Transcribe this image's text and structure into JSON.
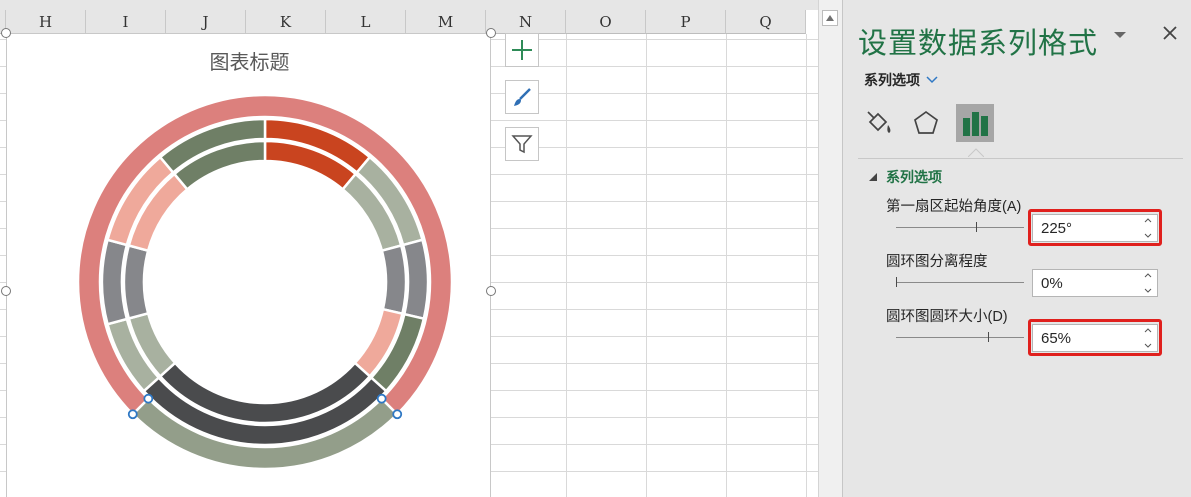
{
  "sheet": {
    "columns": [
      "H",
      "I",
      "J",
      "K",
      "L",
      "M",
      "N",
      "O",
      "P",
      "Q"
    ]
  },
  "chart": {
    "title": "图表标题",
    "side_buttons": [
      "chart-elements-plus-icon",
      "chart-styles-brush-icon",
      "chart-filters-funnel-icon"
    ],
    "colors": {
      "outer_ring": "#dc807d",
      "outer_ring_bottom": "#939e8a",
      "dark": "#4a4b4d",
      "accent_red": "#c9441f",
      "sage": "#a8b1a0",
      "gray": "#86878b",
      "salmon": "#efa99b",
      "olive": "#6f7f66"
    }
  },
  "pane": {
    "title": "设置数据系列格式",
    "tab_dropdown_label": "系列选项",
    "tabs": [
      "fill-line-icon",
      "effects-pentagon-icon",
      "series-options-bars-icon"
    ],
    "section_title": "系列选项",
    "first_slice_angle_label": "第一扇区起始角度(A)",
    "first_slice_angle_value": "225°",
    "first_slice_angle_pct": 0.625,
    "explosion_label": "圆环图分离程度",
    "explosion_value": "0%",
    "explosion_pct": 0.0,
    "hole_size_label": "圆环图圆环大小(D)",
    "hole_size_value": "65%",
    "hole_size_pct": 0.72
  }
}
